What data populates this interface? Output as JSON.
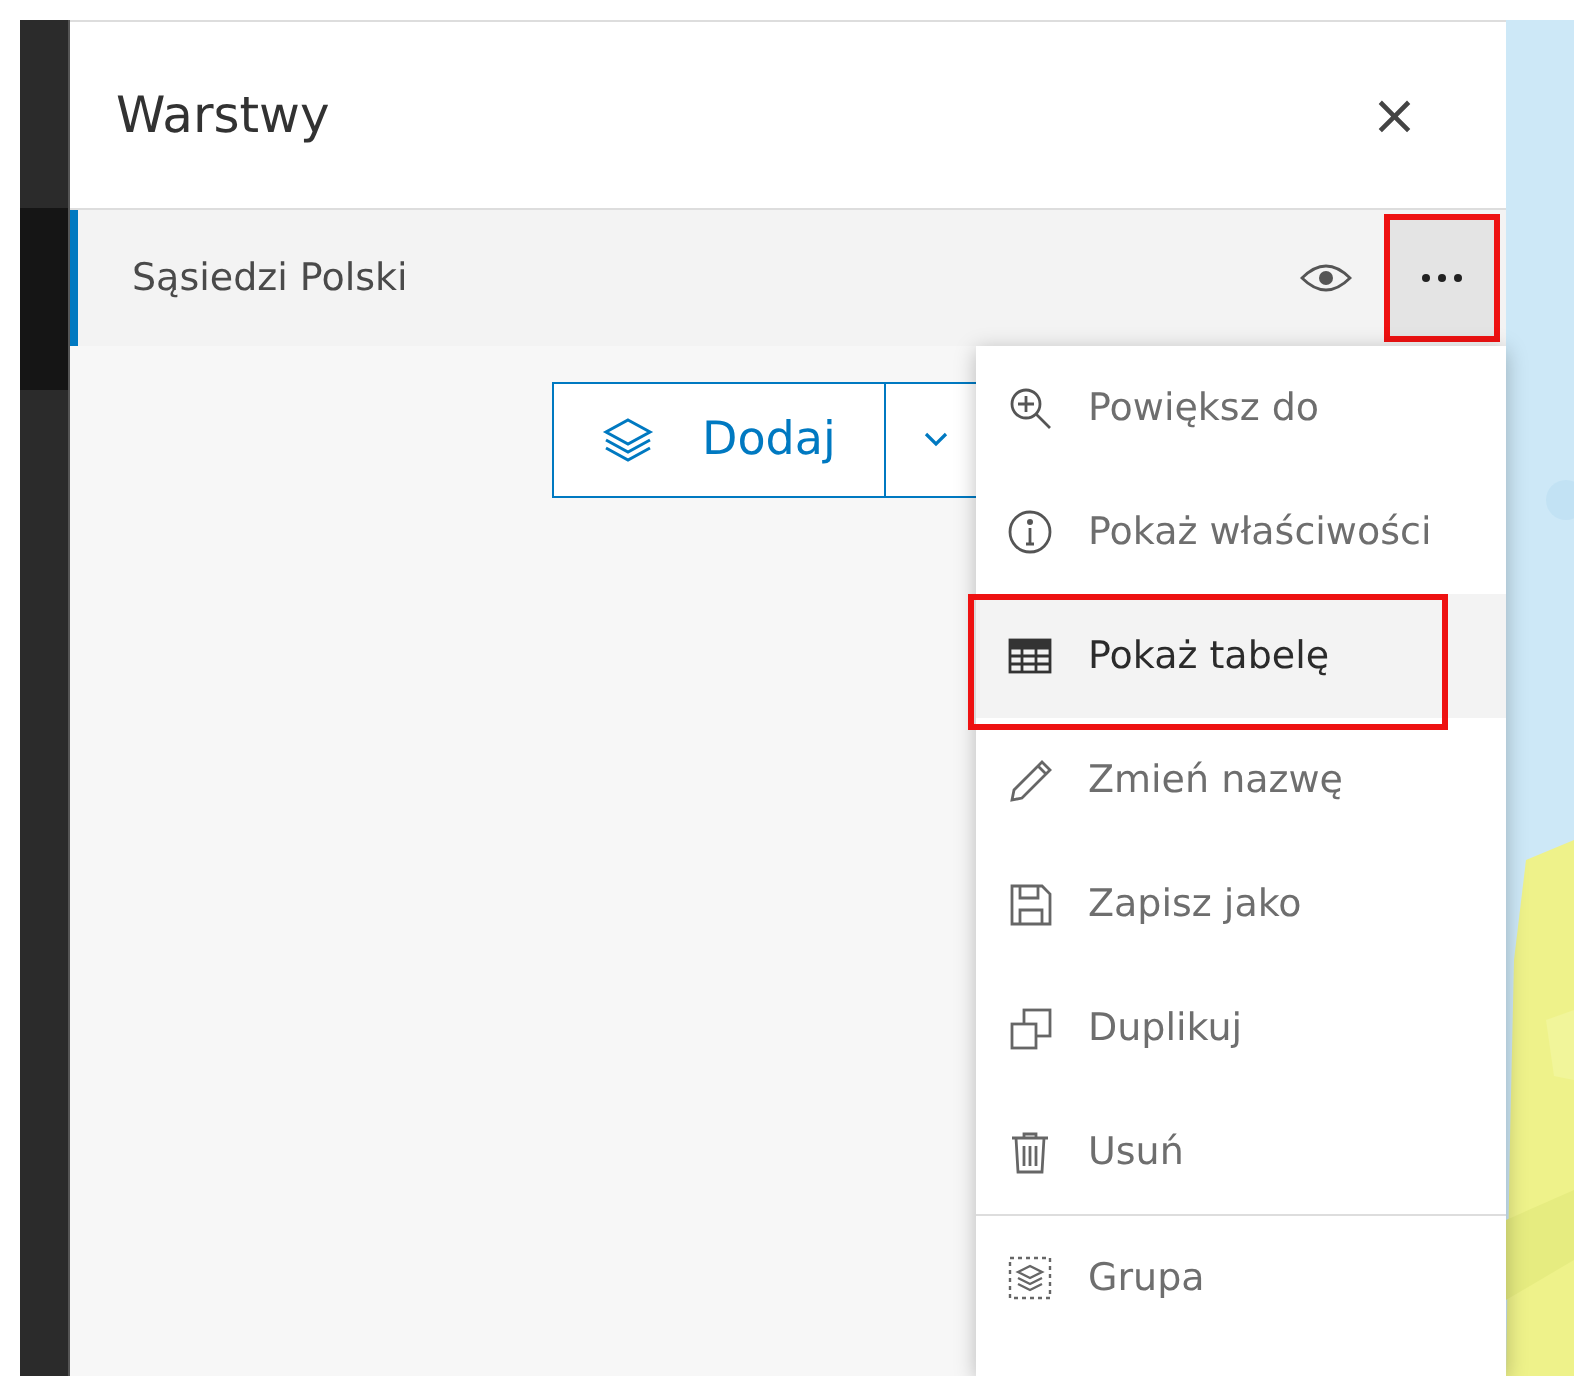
{
  "panel": {
    "title": "Warstwy",
    "close": "×"
  },
  "layers": [
    {
      "name": "Sąsiedzi Polski",
      "selected": true,
      "visible": true,
      "options_outlined": true
    }
  ],
  "add_button": {
    "label": "Dodaj"
  },
  "menu": {
    "sections": [
      [
        {
          "kind": "zoom",
          "label": "Powiększ do",
          "selected": false,
          "outlined": false
        },
        {
          "kind": "info",
          "label": "Pokaż właściwości",
          "selected": false,
          "outlined": false
        },
        {
          "kind": "table",
          "label": "Pokaż tabelę",
          "selected": true,
          "outlined": true
        },
        {
          "kind": "pencil",
          "label": "Zmień nazwę",
          "selected": false,
          "outlined": false
        },
        {
          "kind": "save",
          "label": "Zapisz jako",
          "selected": false,
          "outlined": false
        },
        {
          "kind": "duplicate",
          "label": "Duplikuj",
          "selected": false,
          "outlined": false
        },
        {
          "kind": "trash",
          "label": "Usuń",
          "selected": false,
          "outlined": false
        }
      ],
      [
        {
          "kind": "group",
          "label": "Grupa",
          "selected": false,
          "outlined": false
        }
      ]
    ]
  }
}
